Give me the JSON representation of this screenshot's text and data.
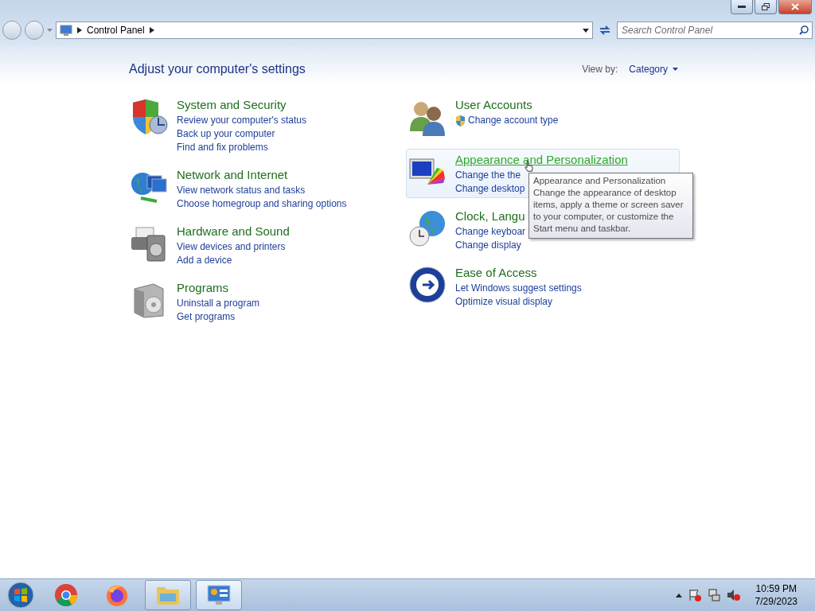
{
  "address_bar": {
    "breadcrumb": [
      "Control Panel"
    ]
  },
  "search": {
    "placeholder": "Search Control Panel"
  },
  "heading": "Adjust your computer's settings",
  "view_by": {
    "label": "View by:",
    "value": "Category"
  },
  "columns": [
    [
      {
        "kind": "security",
        "title": "System and Security",
        "hovered": false,
        "links": [
          {
            "text": "Review your computer's status",
            "shield": false
          },
          {
            "text": "Back up your computer",
            "shield": false
          },
          {
            "text": "Find and fix problems",
            "shield": false
          }
        ]
      },
      {
        "kind": "network",
        "title": "Network and Internet",
        "hovered": false,
        "links": [
          {
            "text": "View network status and tasks",
            "shield": false
          },
          {
            "text": "Choose homegroup and sharing options",
            "shield": false
          }
        ]
      },
      {
        "kind": "hardware",
        "title": "Hardware and Sound",
        "hovered": false,
        "links": [
          {
            "text": "View devices and printers",
            "shield": false
          },
          {
            "text": "Add a device",
            "shield": false
          }
        ]
      },
      {
        "kind": "programs",
        "title": "Programs",
        "hovered": false,
        "links": [
          {
            "text": "Uninstall a program",
            "shield": false
          },
          {
            "text": "Get programs",
            "shield": false
          }
        ]
      }
    ],
    [
      {
        "kind": "users",
        "title": "User Accounts",
        "hovered": false,
        "links": [
          {
            "text": "Change account type",
            "shield": true
          }
        ]
      },
      {
        "kind": "appearance",
        "title": "Appearance and Personalization",
        "hovered": true,
        "links": [
          {
            "text": "Change the the",
            "shield": false
          },
          {
            "text": "Change desktop",
            "shield": false
          }
        ]
      },
      {
        "kind": "clock",
        "title": "Clock, Langu",
        "hovered": false,
        "links": [
          {
            "text": "Change keyboar",
            "shield": false
          },
          {
            "text": "Change display",
            "shield": false
          }
        ]
      },
      {
        "kind": "ease",
        "title": "Ease of Access",
        "hovered": false,
        "links": [
          {
            "text": "Let Windows suggest settings",
            "shield": false
          },
          {
            "text": "Optimize visual display",
            "shield": false
          }
        ]
      }
    ]
  ],
  "tooltip": {
    "title": "Appearance and Personalization",
    "text": "Change the appearance of desktop items, apply a theme or screen saver to your computer, or customize the Start menu and taskbar."
  },
  "taskbar": {
    "apps": [
      {
        "kind": "chrome",
        "selected": false,
        "open": false
      },
      {
        "kind": "firefox",
        "selected": false,
        "open": false
      },
      {
        "kind": "explorer",
        "selected": false,
        "open": true
      },
      {
        "kind": "control",
        "selected": true,
        "open": true
      }
    ],
    "time": "10:59 PM",
    "date": "7/29/2023"
  }
}
